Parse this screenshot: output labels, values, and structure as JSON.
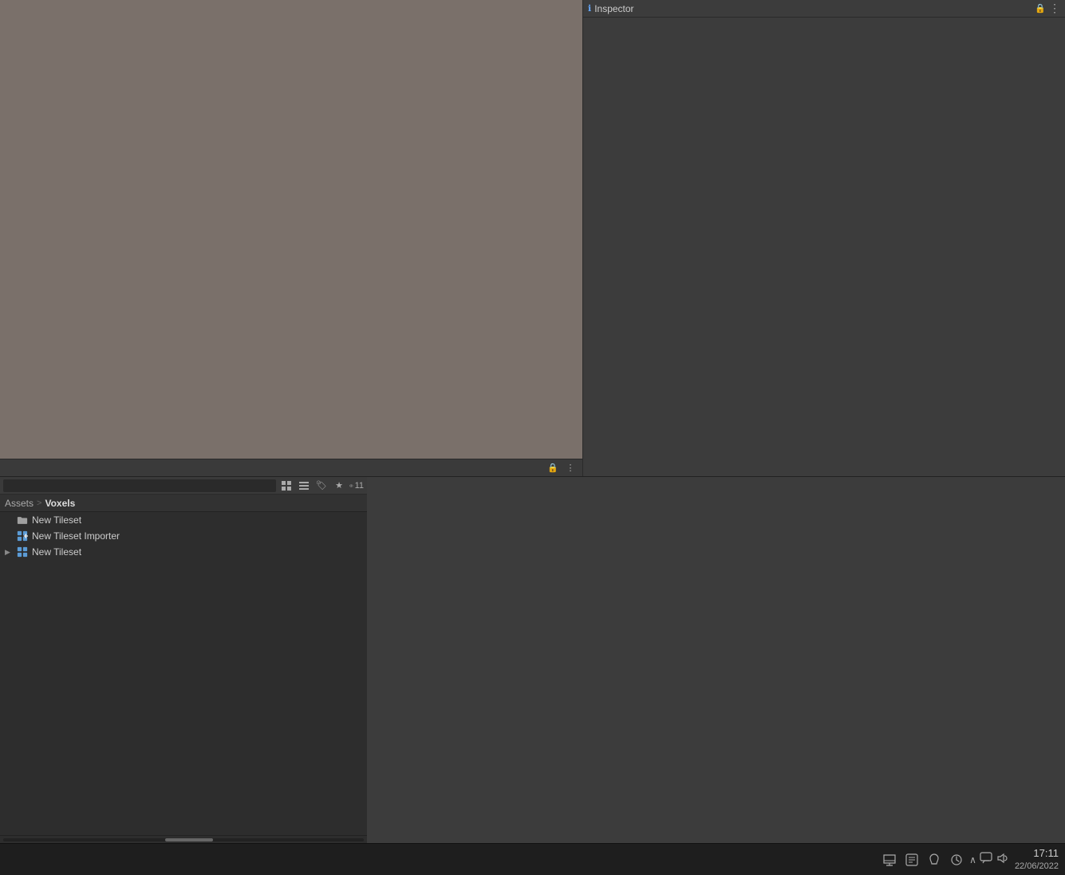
{
  "inspector": {
    "title": "Inspector",
    "lock_icon": "🔒",
    "more_icon": "⋮"
  },
  "scene": {
    "viewport_color": "#7a706a"
  },
  "scene_toolbar": {
    "icons": [
      "⊞",
      "⊞",
      "✏",
      "★",
      "👁"
    ],
    "count": "11",
    "lock_label": "🔒",
    "more_label": "⋮"
  },
  "assets": {
    "search_placeholder": "",
    "toolbar_icons": [
      "⊞",
      "⊞",
      "✏",
      "★",
      "👁"
    ]
  },
  "breadcrumb": {
    "items": [
      {
        "label": "Assets",
        "active": false
      },
      {
        "label": "Voxels",
        "active": true
      }
    ],
    "separator": ">"
  },
  "file_list": [
    {
      "id": 1,
      "name": "New Tileset",
      "type": "folder",
      "indent": false,
      "expandable": false
    },
    {
      "id": 2,
      "name": "New Tileset Importer",
      "type": "tileset",
      "indent": false,
      "expandable": false
    },
    {
      "id": 3,
      "name": "New Tileset",
      "type": "tileset",
      "indent": false,
      "expandable": true
    }
  ],
  "taskbar": {
    "tray_icons": [
      "⌨",
      "📋",
      "🔔",
      "🔄"
    ],
    "system_tray": [
      "∧",
      "💬",
      "🔊"
    ],
    "time": "17:11",
    "date": "22/06/2022"
  }
}
